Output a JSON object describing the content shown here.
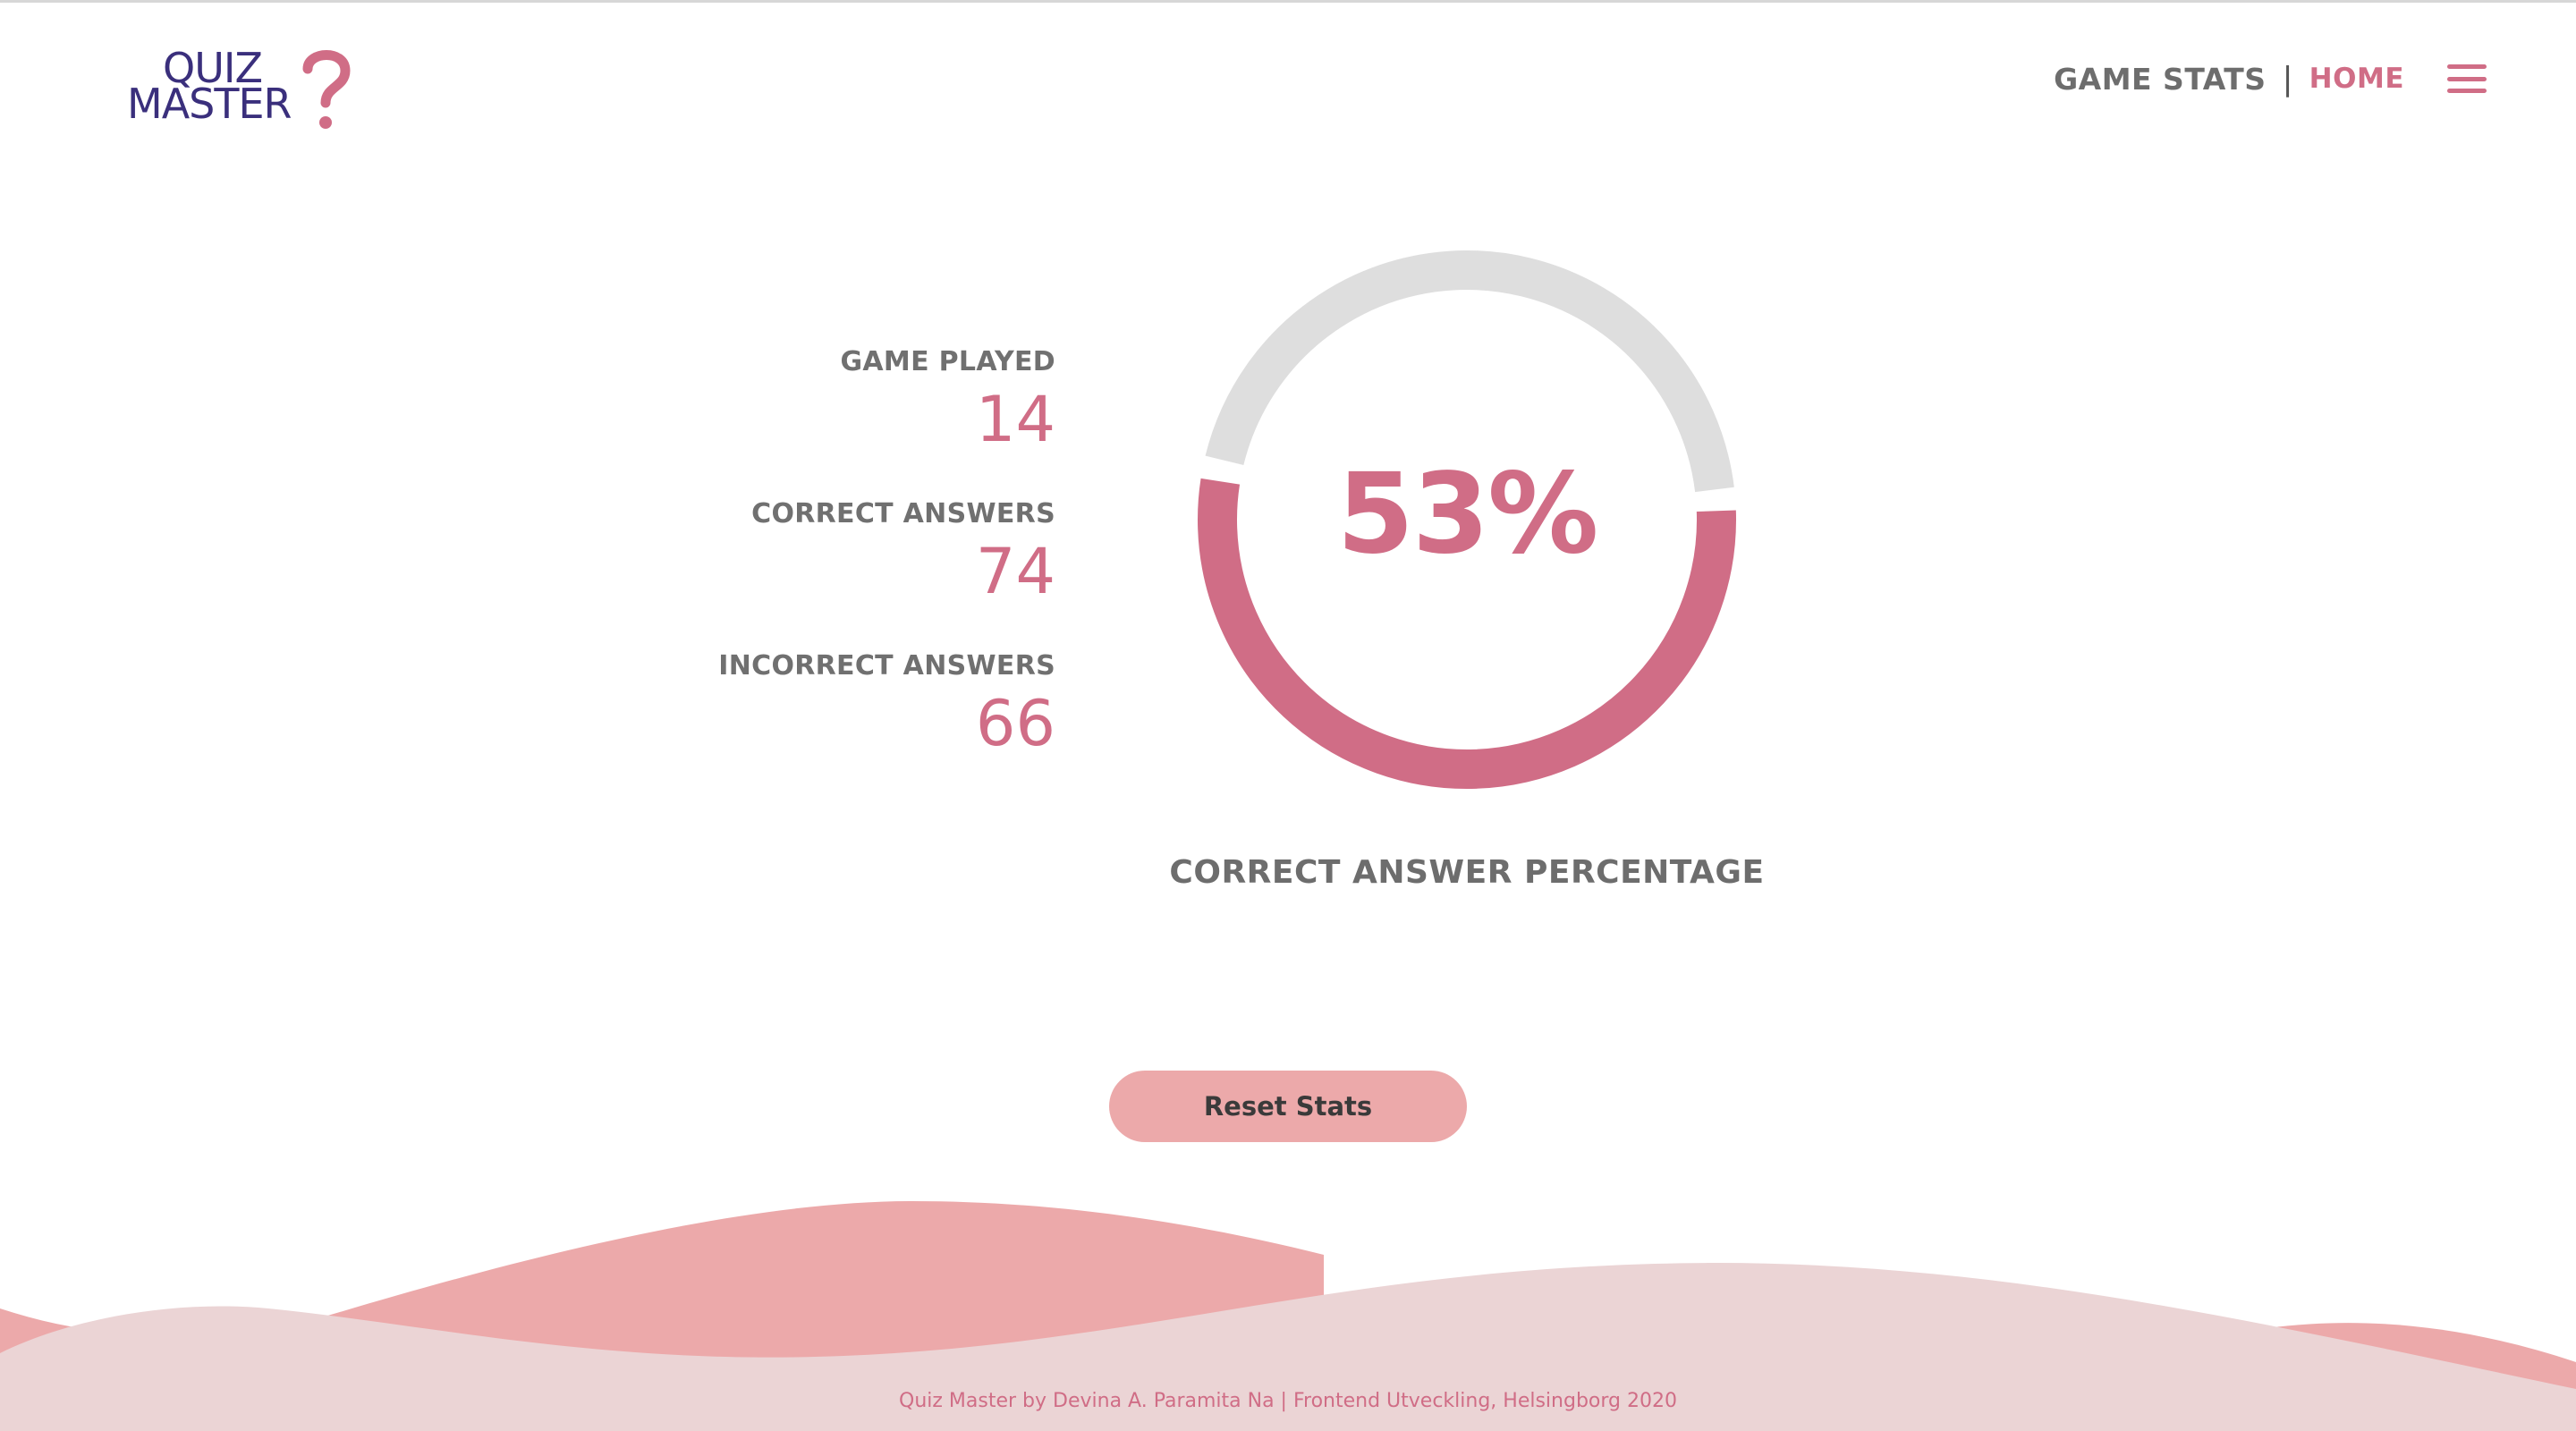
{
  "brand": {
    "logo_line1": "QUIZ",
    "logo_line2": "MASTER",
    "logo_mark": "?"
  },
  "nav": {
    "game_stats": "GAME STATS",
    "separator": "|",
    "home": "HOME",
    "menu_icon": "hamburger-menu-icon"
  },
  "stats": [
    {
      "label": "GAME PLAYED",
      "value": "14"
    },
    {
      "label": "CORRECT ANSWERS",
      "value": "74"
    },
    {
      "label": "INCORRECT ANSWERS",
      "value": "66"
    }
  ],
  "percentage": {
    "value_text": "53%",
    "fraction": 0.53,
    "caption": "CORRECT ANSWER PERCENTAGE"
  },
  "actions": {
    "reset_label": "Reset Stats"
  },
  "footer": {
    "text": "Quiz Master by Devina A. Paramita Na | Frontend Utveckling, Helsingborg 2020"
  },
  "colors": {
    "accent": "#d06d86",
    "brand_dark": "#3a2f7c",
    "ring_track": "#dedede",
    "button": "#eca9aa",
    "wave_back": "#eca9aa",
    "wave_front": "#ebd4d5"
  }
}
